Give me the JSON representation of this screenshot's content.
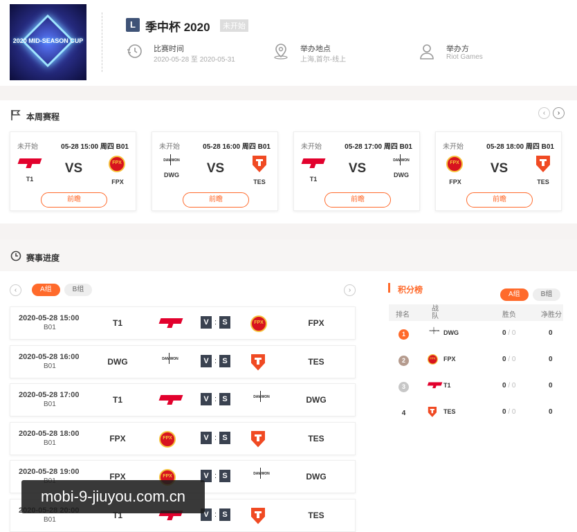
{
  "event": {
    "badge": "L",
    "title": "季中杯 2020",
    "status": "未开始",
    "logo_text": "2020 MID-SEASON CUP",
    "info": [
      {
        "label": "比赛时间",
        "value": "2020-05-28 至 2020-05-31",
        "icon": "clock-icon"
      },
      {
        "label": "举办地点",
        "value": "上海,首尔-线上",
        "icon": "location-icon"
      },
      {
        "label": "举办方",
        "value": "Riot Games",
        "icon": "organizer-icon"
      }
    ]
  },
  "week": {
    "title": "本周赛程",
    "prev_arrow": "‹",
    "next_arrow": "›",
    "cards": [
      {
        "status": "未开始",
        "time": "05-28 15:00 周四 B01",
        "team_a": "T1",
        "logo_a": "t1",
        "vs": "VS",
        "team_b": "FPX",
        "logo_b": "fpx",
        "button": "前瞻"
      },
      {
        "status": "未开始",
        "time": "05-28 16:00 周四 B01",
        "team_a": "DWG",
        "logo_a": "dwg",
        "vs": "VS",
        "team_b": "TES",
        "logo_b": "tes",
        "button": "前瞻"
      },
      {
        "status": "未开始",
        "time": "05-28 17:00 周四 B01",
        "team_a": "T1",
        "logo_a": "t1",
        "vs": "VS",
        "team_b": "DWG",
        "logo_b": "dwg",
        "button": "前瞻"
      },
      {
        "status": "未开始",
        "time": "05-28 18:00 周四 B01",
        "team_a": "FPX",
        "logo_a": "fpx",
        "vs": "VS",
        "team_b": "TES",
        "logo_b": "tes",
        "button": "前瞻"
      }
    ]
  },
  "progress": {
    "title": "赛事进度",
    "tabs": [
      "A组",
      "B组"
    ],
    "active_tab": "A组",
    "vs_left": "V",
    "vs_colon": ":",
    "vs_right": "S",
    "matches": [
      {
        "datetime": "2020-05-28 15:00",
        "bo": "B01",
        "team_a": "T1",
        "logo_a": "t1",
        "team_b": "FPX",
        "logo_b": "fpx"
      },
      {
        "datetime": "2020-05-28 16:00",
        "bo": "B01",
        "team_a": "DWG",
        "logo_a": "dwg",
        "team_b": "TES",
        "logo_b": "tes"
      },
      {
        "datetime": "2020-05-28 17:00",
        "bo": "B01",
        "team_a": "T1",
        "logo_a": "t1",
        "team_b": "DWG",
        "logo_b": "dwg"
      },
      {
        "datetime": "2020-05-28 18:00",
        "bo": "B01",
        "team_a": "FPX",
        "logo_a": "fpx",
        "team_b": "TES",
        "logo_b": "tes"
      },
      {
        "datetime": "2020-05-28 19:00",
        "bo": "B01",
        "team_a": "FPX",
        "logo_a": "fpx",
        "team_b": "DWG",
        "logo_b": "dwg"
      },
      {
        "datetime": "2020-05-28 20:00",
        "bo": "B01",
        "team_a": "T1",
        "logo_a": "t1",
        "team_b": "TES",
        "logo_b": "tes"
      }
    ]
  },
  "standings": {
    "title": "积分榜",
    "tabs": [
      "A组",
      "B组"
    ],
    "active_tab": "A组",
    "headers": {
      "rank": "排名",
      "team": "战队",
      "wl": "胜负",
      "net": "净胜分"
    },
    "rows": [
      {
        "rank": "1",
        "rank_color": "#ff6a2b",
        "team": "DWG",
        "logo": "dwg",
        "wins": "0",
        "sep": "/",
        "losses": "0",
        "net": "0"
      },
      {
        "rank": "2",
        "rank_color": "#b59b8e",
        "team": "FPX",
        "logo": "fpx",
        "wins": "0",
        "sep": "/",
        "losses": "0",
        "net": "0"
      },
      {
        "rank": "3",
        "rank_color": "#c7c7c7",
        "team": "T1",
        "logo": "t1",
        "wins": "0",
        "sep": "/",
        "losses": "0",
        "net": "0"
      },
      {
        "rank": "4",
        "rank_color": "",
        "team": "TES",
        "logo": "tes",
        "wins": "0",
        "sep": "/",
        "losses": "0",
        "net": "0"
      }
    ]
  },
  "watermark": "mobi-9-jiuyou.com.cn"
}
